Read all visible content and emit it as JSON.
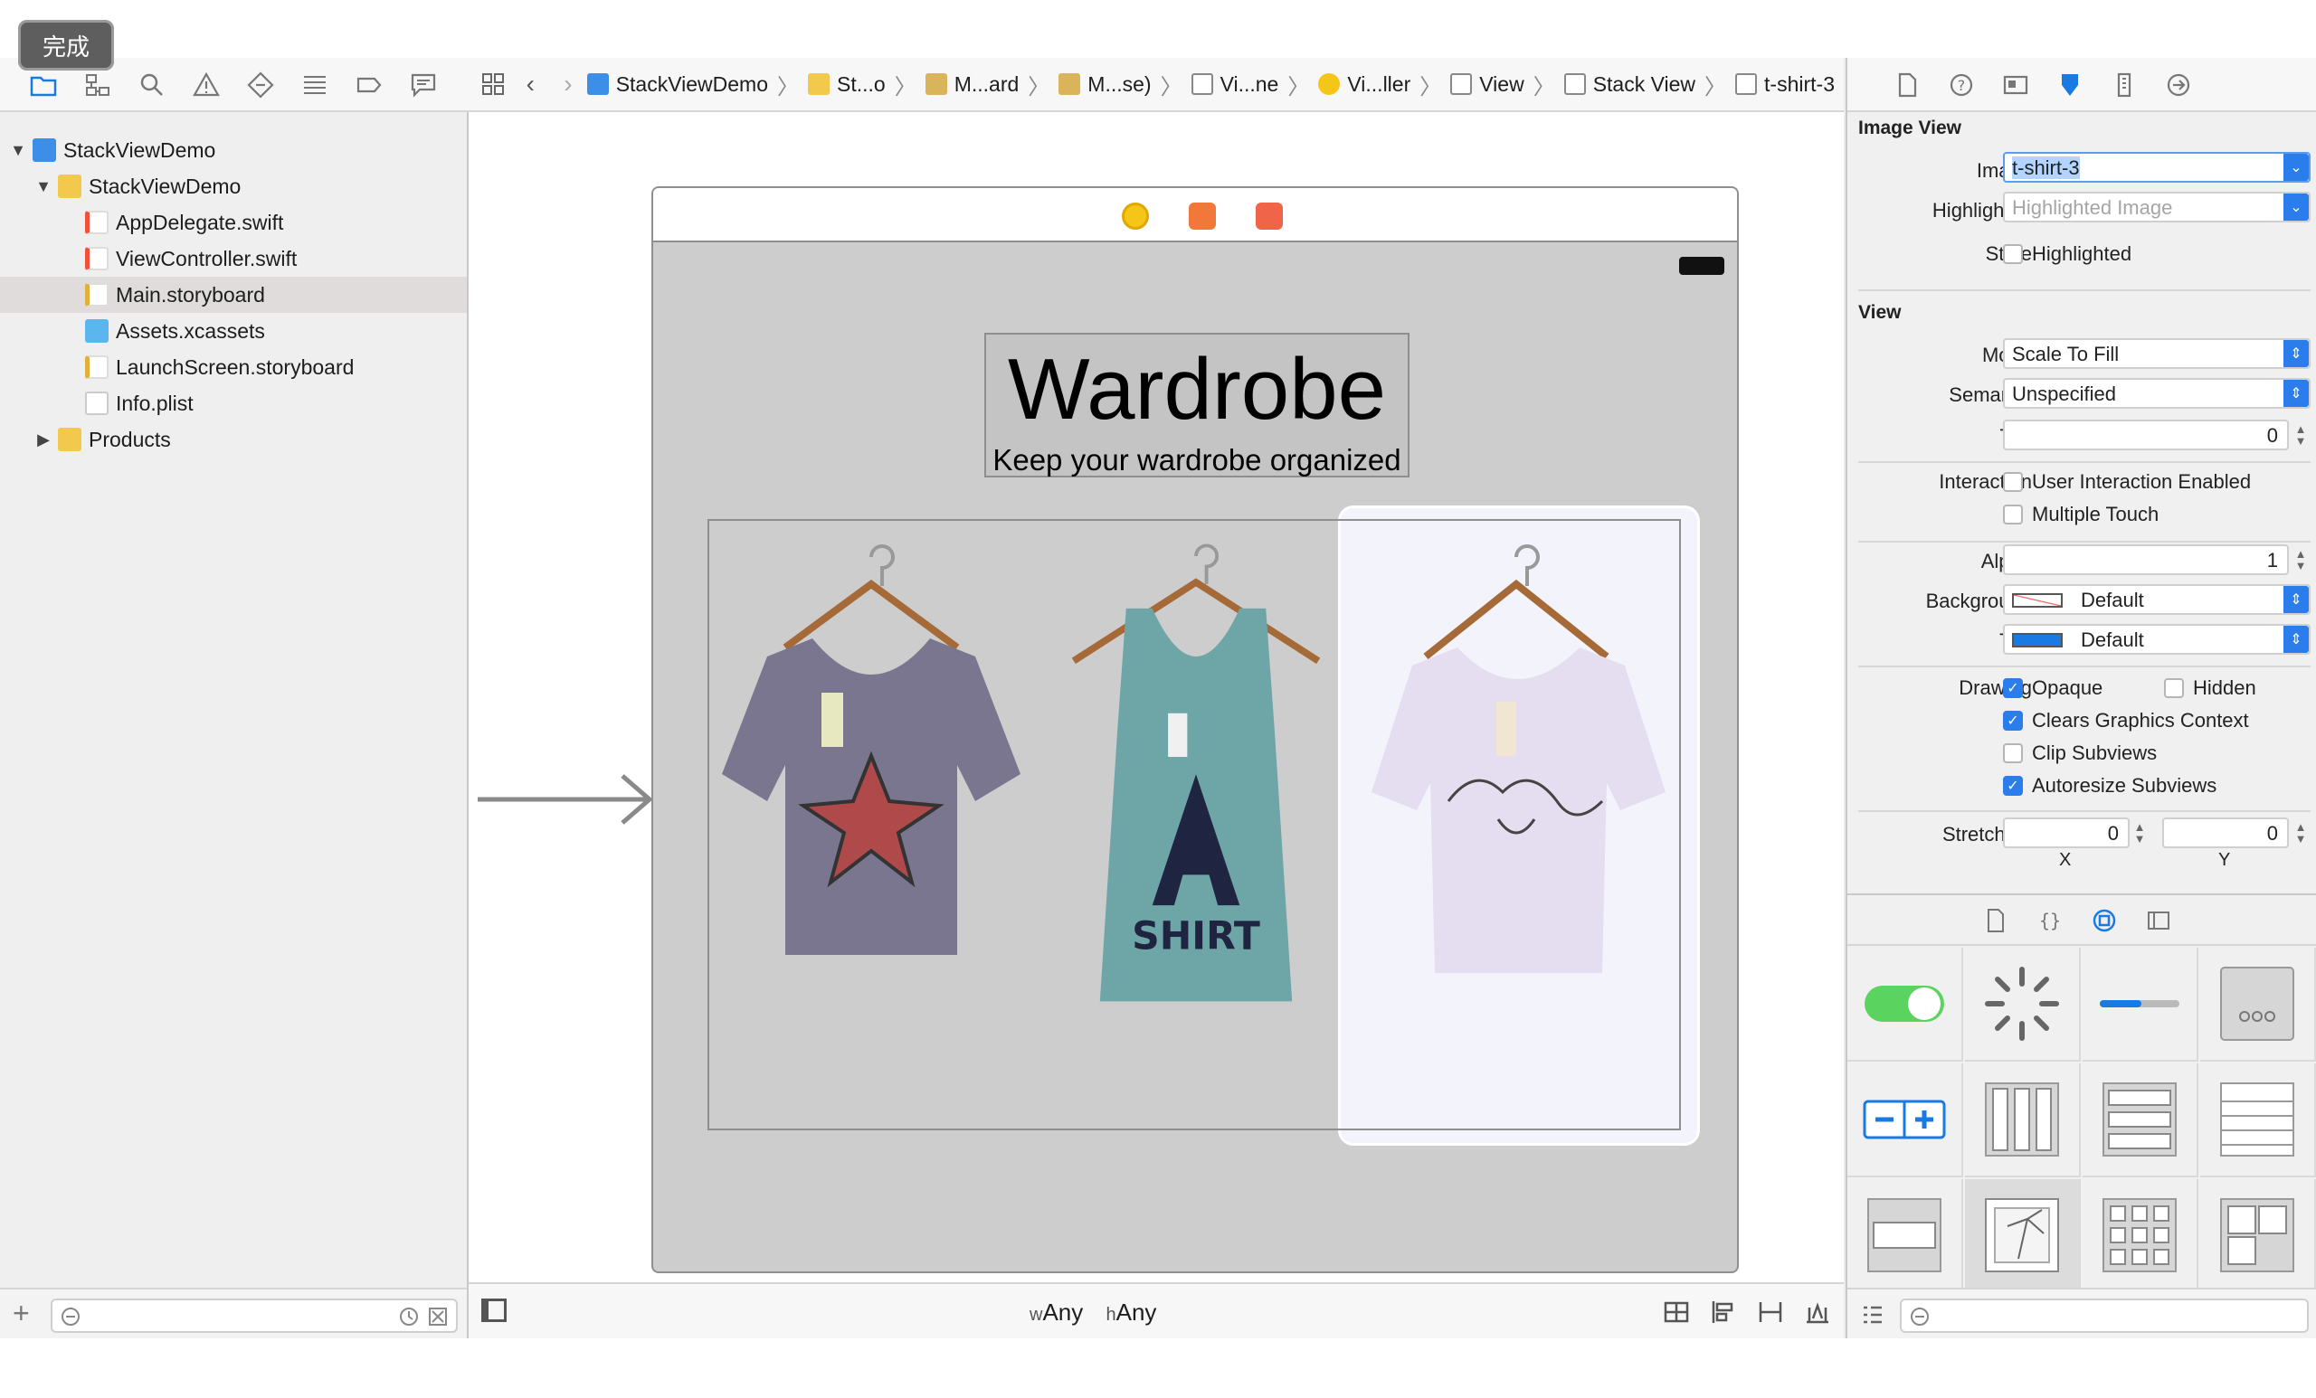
{
  "done_button": "完成",
  "navigator": {
    "tree": [
      {
        "label": "StackViewDemo",
        "type": "project",
        "level": 0,
        "expanded": true
      },
      {
        "label": "StackViewDemo",
        "type": "folder",
        "level": 1,
        "expanded": true
      },
      {
        "label": "AppDelegate.swift",
        "type": "swift",
        "level": 2
      },
      {
        "label": "ViewController.swift",
        "type": "swift",
        "level": 2
      },
      {
        "label": "Main.storyboard",
        "type": "storyboard",
        "level": 2,
        "selected": true
      },
      {
        "label": "Assets.xcassets",
        "type": "assets",
        "level": 2
      },
      {
        "label": "LaunchScreen.storyboard",
        "type": "storyboard",
        "level": 2
      },
      {
        "label": "Info.plist",
        "type": "plist",
        "level": 2
      },
      {
        "label": "Products",
        "type": "folder",
        "level": 1,
        "expanded": false
      }
    ]
  },
  "jumpbar": {
    "crumbs": [
      "StackViewDemo",
      "St...o",
      "M...ard",
      "M...se)",
      "Vi...ne",
      "Vi...ller",
      "View",
      "Stack View",
      "t-shirt-3"
    ]
  },
  "scene": {
    "title": "Wardrobe",
    "subtitle": "Keep your wardrobe organized"
  },
  "size_class": {
    "w_prefix": "w",
    "w_value": "Any",
    "h_prefix": "h",
    "h_value": "Any"
  },
  "inspector": {
    "image_view": {
      "section": "Image View",
      "image_label": "Image",
      "image_value": "t-shirt-3",
      "highlighted_label": "Highlighted",
      "highlighted_placeholder": "Highlighted Image",
      "state_label": "State",
      "state_checkbox": "Highlighted"
    },
    "view": {
      "section": "View",
      "mode_label": "Mode",
      "mode_value": "Scale To Fill",
      "semantic_label": "Semantic",
      "semantic_value": "Unspecified",
      "tag_label": "Tag",
      "tag_value": "0",
      "interaction_label": "Interaction",
      "user_interaction": "User Interaction Enabled",
      "multiple_touch": "Multiple Touch",
      "alpha_label": "Alpha",
      "alpha_value": "1",
      "background_label": "Background",
      "background_value": "Default",
      "tint_label": "Tint",
      "tint_value": "Default",
      "drawing_label": "Drawing",
      "opaque": "Opaque",
      "hidden": "Hidden",
      "clears": "Clears Graphics Context",
      "clip": "Clip Subviews",
      "autoresize": "Autoresize Subviews",
      "stretching_label": "Stretching",
      "stretch_x_value": "0",
      "stretch_y_value": "0",
      "x_label": "X",
      "y_label": "Y"
    }
  },
  "colors": {
    "accent": "#2a7dea",
    "switch_green": "#5bd35f",
    "tint_blue": "#1a7ae4",
    "shirt1": "#7a7690",
    "shirt2": "#6ea6a8",
    "shirt3": "#e4def0"
  }
}
